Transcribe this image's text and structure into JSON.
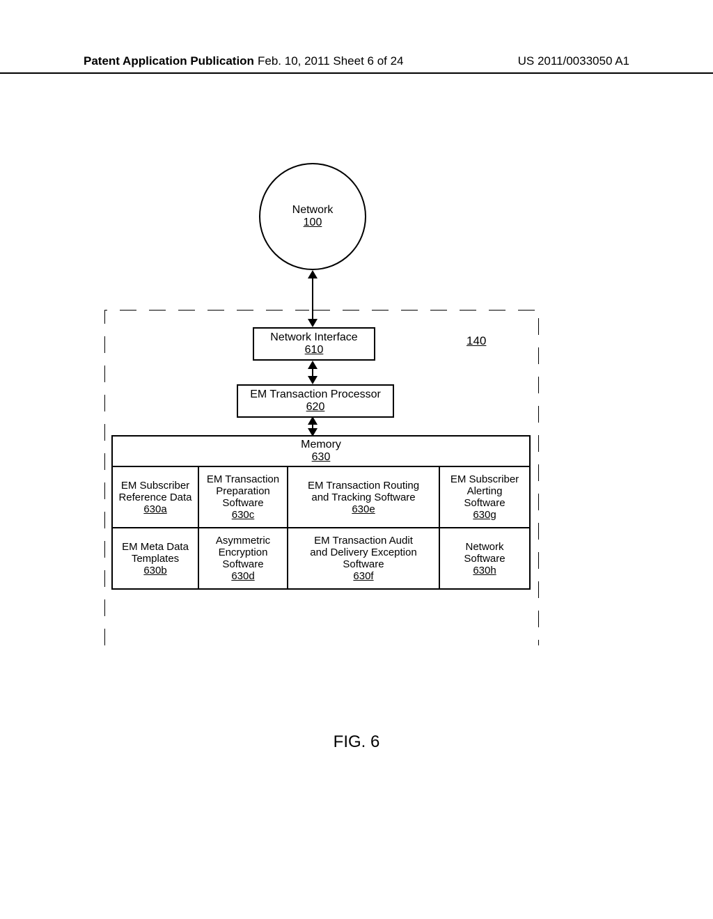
{
  "header": {
    "left": "Patent Application Publication",
    "mid": "Feb. 10, 2011   Sheet 6 of 24",
    "right": "US 2011/0033050 A1"
  },
  "network": {
    "label": "Network",
    "ref": "100"
  },
  "container_ref": "140",
  "ni": {
    "label": "Network Interface",
    "ref": "610"
  },
  "proc": {
    "label": "EM Transaction Processor",
    "ref": "620"
  },
  "memory": {
    "label": "Memory",
    "ref": "630"
  },
  "cells": {
    "a": {
      "l1": "EM Subscriber",
      "l2": "Reference Data",
      "ref": "630a"
    },
    "b": {
      "l1": "EM Meta Data",
      "l2": "Templates",
      "ref": "630b"
    },
    "c": {
      "l1": "EM Transaction",
      "l2": "Preparation",
      "l3": "Software",
      "ref": "630c"
    },
    "d": {
      "l1": "Asymmetric",
      "l2": "Encryption",
      "l3": "Software",
      "ref": "630d"
    },
    "e": {
      "l1": "EM Transaction Routing",
      "l2": "and Tracking Software",
      "ref": "630e"
    },
    "f": {
      "l1": "EM Transaction Audit",
      "l2": "and Delivery Exception",
      "l3": "Software",
      "ref": "630f"
    },
    "g": {
      "l1": "EM Subscriber",
      "l2": "Alerting",
      "l3": "Software",
      "ref": "630g"
    },
    "h": {
      "l1": "Network",
      "l2": "Software",
      "ref": "630h"
    }
  },
  "figure": "FIG. 6"
}
